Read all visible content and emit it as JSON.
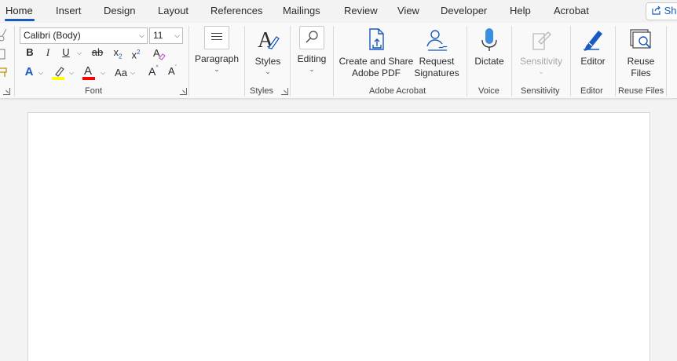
{
  "tabs": [
    {
      "label": "Home",
      "active": true
    },
    {
      "label": "Insert"
    },
    {
      "label": "Design"
    },
    {
      "label": "Layout"
    },
    {
      "label": "References"
    },
    {
      "label": "Mailings"
    },
    {
      "label": "Review"
    },
    {
      "label": "View"
    },
    {
      "label": "Developer"
    },
    {
      "label": "Help"
    },
    {
      "label": "Acrobat"
    }
  ],
  "share_label": "Share",
  "font": {
    "name": "Calibri (Body)",
    "size": "11",
    "group_label": "Font",
    "bold": "B",
    "italic": "I",
    "underline": "U",
    "strike": "ab",
    "subscript": "x",
    "superscript": "x",
    "sub_mark": "2",
    "sup_mark": "2",
    "change_case": "Aa",
    "grow": "A",
    "shrink": "A",
    "font_color_letter": "A",
    "text_effects_letter": "A"
  },
  "paragraph": {
    "label": "Paragraph"
  },
  "styles": {
    "label": "Styles",
    "group_label": "Styles"
  },
  "editing": {
    "label": "Editing"
  },
  "acrobat": {
    "create_line1": "Create and Share",
    "create_line2": "Adobe PDF",
    "request_line1": "Request",
    "request_line2": "Signatures",
    "group_label": "Adobe Acrobat"
  },
  "voice": {
    "dictate": "Dictate",
    "group_label": "Voice"
  },
  "sensitivity": {
    "label": "Sensitivity",
    "group_label": "Sensitivity"
  },
  "editor": {
    "label": "Editor",
    "group_label": "Editor"
  },
  "reuse": {
    "line1": "Reuse",
    "line2": "Files",
    "group_label": "Reuse Files"
  },
  "colors": {
    "accent": "#185abd",
    "highlight": "#ffff00",
    "font_color": "#ff0000"
  }
}
